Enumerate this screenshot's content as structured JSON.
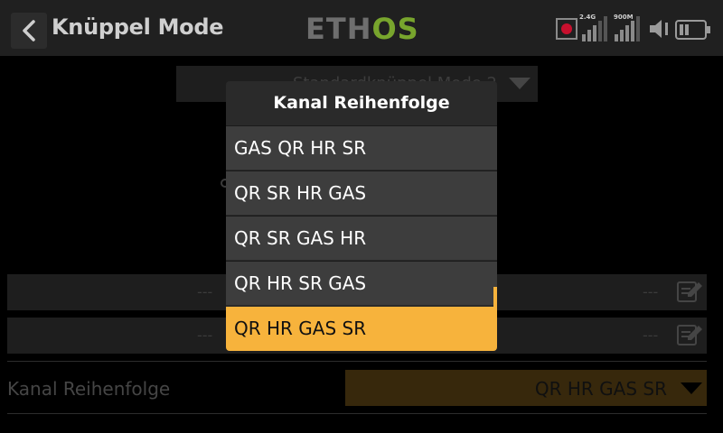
{
  "header": {
    "title": "Knüppel Mode",
    "logo_left": "ETH",
    "logo_right": "OS",
    "rf_24": "2.4G",
    "rf_900": "900M"
  },
  "page": {
    "mode_select_value": "Standardknüppel Mode 2",
    "row_placeholder": "---",
    "channel_order_label": "Kanal Reihenfolge",
    "channel_order_value": "QR HR GAS SR"
  },
  "popup": {
    "title": "Kanal Reihenfolge",
    "options": [
      {
        "label": "GAS QR HR SR"
      },
      {
        "label": "QR SR HR GAS"
      },
      {
        "label": "QR SR GAS HR"
      },
      {
        "label": "QR HR SR GAS"
      },
      {
        "label": "QR HR GAS SR"
      }
    ],
    "selected_index": 4
  },
  "colors": {
    "accent": "#f7b33c",
    "logo_green": "#78a52d",
    "header_bg": "#202020",
    "popup_bg": "#3d3d3d"
  },
  "icons": [
    "back-arrow-icon",
    "record-icon",
    "signal-24g-icon",
    "signal-900m-icon",
    "speaker-icon",
    "battery-icon",
    "edit-icon",
    "dropdown-arrow-icon"
  ]
}
